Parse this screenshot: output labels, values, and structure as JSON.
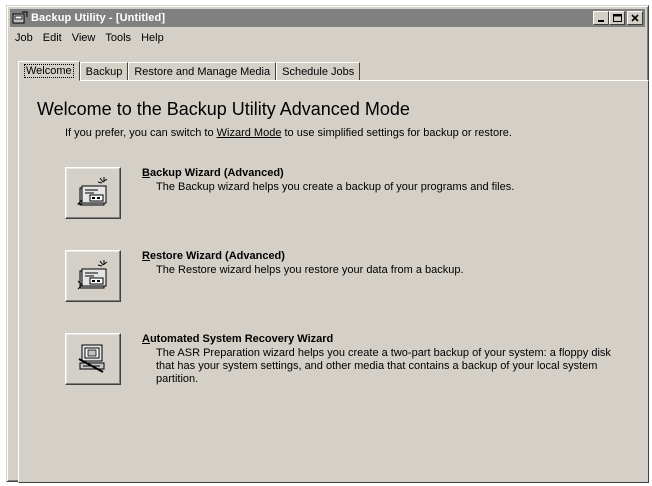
{
  "window": {
    "title": "Backup Utility - [Untitled]",
    "controls": {
      "minimize": "_",
      "maximize": "□",
      "close": "×"
    }
  },
  "menu": [
    "Job",
    "Edit",
    "View",
    "Tools",
    "Help"
  ],
  "tabs": [
    {
      "label": "Welcome",
      "active": true
    },
    {
      "label": "Backup",
      "active": false
    },
    {
      "label": "Restore and Manage Media",
      "active": false
    },
    {
      "label": "Schedule Jobs",
      "active": false
    }
  ],
  "welcome": {
    "heading": "Welcome to the Backup Utility Advanced Mode",
    "intro_prefix": "If you prefer, you can switch to ",
    "intro_link": "Wizard Mode",
    "intro_suffix": " to use simplified settings for backup or restore."
  },
  "wizards": [
    {
      "accel": "B",
      "title_rest": "ackup Wizard (Advanced)",
      "description": "The Backup wizard helps you create a backup of your programs and files.",
      "icon": "backup-wizard-icon"
    },
    {
      "accel": "R",
      "title_rest": "estore Wizard (Advanced)",
      "description": "The Restore wizard helps you restore your data from a backup.",
      "icon": "restore-wizard-icon"
    },
    {
      "accel": "A",
      "title_rest": "utomated System Recovery Wizard",
      "description": "The ASR Preparation wizard helps you create a two-part backup of your system: a floppy disk that has your system settings, and other media that contains a backup of your local system partition.",
      "icon": "asr-wizard-icon"
    }
  ]
}
